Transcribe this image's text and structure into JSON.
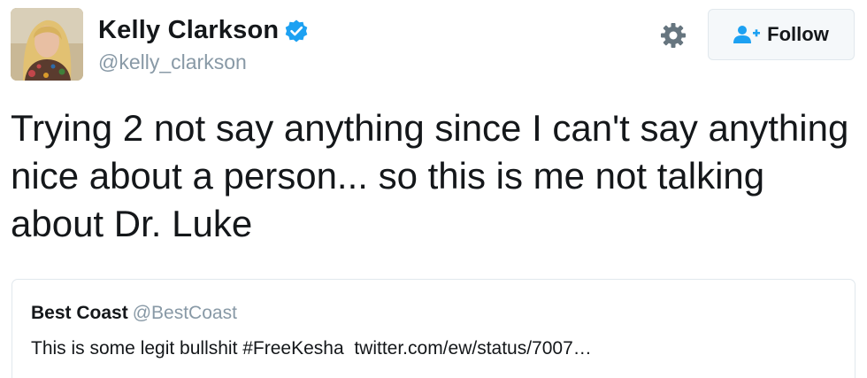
{
  "tweet": {
    "author": {
      "display_name": "Kelly Clarkson",
      "handle": "@kelly_clarkson",
      "verified": true,
      "avatar_icon": "profile-photo"
    },
    "text": "Trying 2 not say anything since I can't say anything nice about a person... so this is me not talking about Dr. Luke",
    "actions": {
      "settings_icon": "gear-icon",
      "follow_label": "Follow",
      "follow_icon": "add-user-icon"
    },
    "quoted_tweet": {
      "display_name": "Best Coast",
      "handle": "@BestCoast",
      "text": "This is some legit bullshit #FreeKesha  twitter.com/ew/status/7007…"
    }
  },
  "colors": {
    "verified_blue": "#1da1f2",
    "link_blue": "#1da1f2",
    "text_primary": "#14171a",
    "text_secondary": "#8899a6",
    "border": "#e1e8ed",
    "button_bg": "#f5f8fa",
    "icon_gray": "#66757f"
  }
}
